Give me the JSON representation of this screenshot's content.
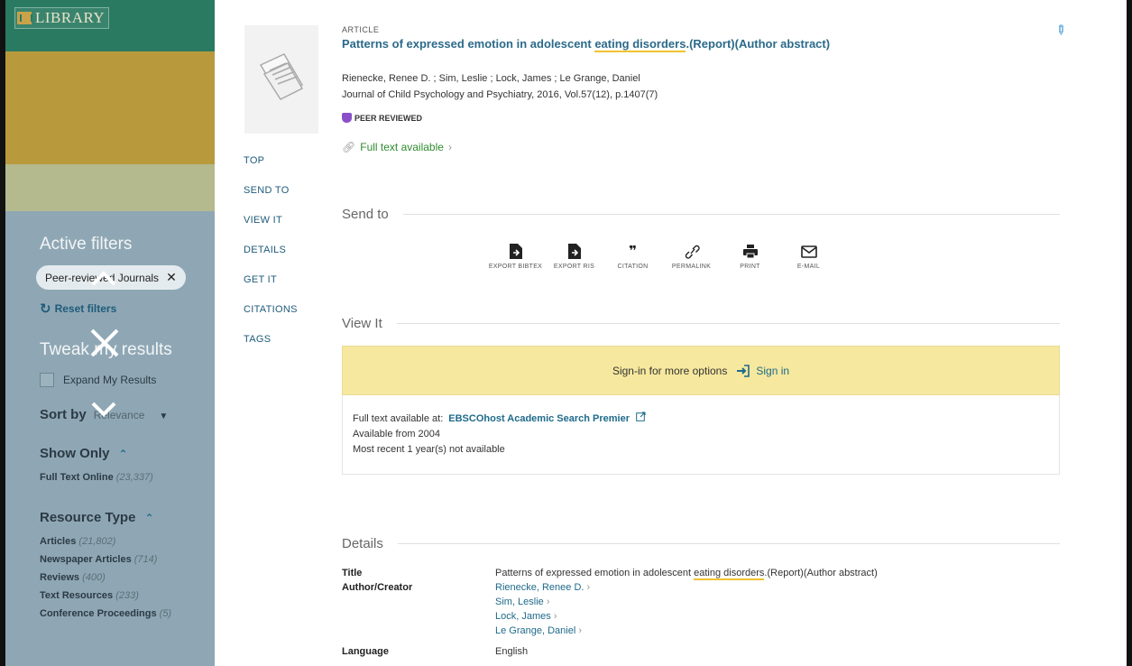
{
  "sidebar": {
    "logo_text": "LIBRARY",
    "active_filters_heading": "Active filters",
    "filter_chip": "Peer-reviewed Journals",
    "reset_filters": "Reset filters",
    "tweak_heading": "Tweak my results",
    "expand_label": "Expand My Results",
    "sort_label": "Sort by",
    "sort_value": "Relevance",
    "show_only_heading": "Show Only",
    "show_only_items": [
      {
        "label": "Full Text Online",
        "count": "(23,337)"
      }
    ],
    "resource_type_heading": "Resource Type",
    "resource_type_items": [
      {
        "label": "Articles",
        "count": "(21,802)"
      },
      {
        "label": "Newspaper Articles",
        "count": "(714)"
      },
      {
        "label": "Reviews",
        "count": "(400)"
      },
      {
        "label": "Text Resources",
        "count": "(233)"
      },
      {
        "label": "Conference Proceedings",
        "count": "(5)"
      }
    ]
  },
  "nav": {
    "items": [
      "TOP",
      "SEND TO",
      "VIEW IT",
      "DETAILS",
      "GET IT",
      "CITATIONS",
      "TAGS"
    ]
  },
  "record": {
    "type": "ARTICLE",
    "title_before": "Patterns of expressed emotion in adolescent ",
    "title_highlight": "eating disorders",
    "title_after": ".(Report)(Author abstract)",
    "authors": "Rienecke, Renee D. ; Sim, Leslie ; Lock, James ; Le Grange, Daniel",
    "journal": "Journal of Child Psychology and Psychiatry, 2016, Vol.57(12), p.1407(7)",
    "peer_reviewed": "PEER REVIEWED",
    "full_text": "Full text available"
  },
  "send_to": {
    "heading": "Send to",
    "actions": [
      {
        "label": "EXPORT BIBTEX",
        "icon": "file-export-icon"
      },
      {
        "label": "EXPORT RIS",
        "icon": "file-export-icon"
      },
      {
        "label": "CITATION",
        "icon": "quote-icon"
      },
      {
        "label": "PERMALINK",
        "icon": "link-icon"
      },
      {
        "label": "PRINT",
        "icon": "printer-icon"
      },
      {
        "label": "E-MAIL",
        "icon": "envelope-icon"
      }
    ]
  },
  "view_it": {
    "heading": "View It",
    "signin_prompt": "Sign-in for more options",
    "signin_link": "Sign in",
    "available_at_label": "Full text available at:",
    "provider": "EBSCOhost Academic Search Premier",
    "available_from": "Available from 2004",
    "embargo": "Most recent 1 year(s) not available"
  },
  "details": {
    "heading": "Details",
    "title_label": "Title",
    "title_before": "Patterns of expressed emotion in adolescent ",
    "title_highlight": "eating disorders",
    "title_after": ".(Report)(Author abstract)",
    "author_label": "Author/Creator",
    "authors": [
      "Rienecke, Renee D.",
      "Sim, Leslie",
      "Lock, James",
      "Le Grange, Daniel"
    ],
    "language_label": "Language",
    "language": "English"
  },
  "colors": {
    "header_green": "#2a7a62",
    "band_gold": "#b89a3c",
    "band_olive": "#b4b98e",
    "sidebar_bg": "#8fa7b4",
    "link_blue": "#1e6a8a",
    "signin_yellow": "#f6e89e",
    "highlight": "#f1c232"
  }
}
